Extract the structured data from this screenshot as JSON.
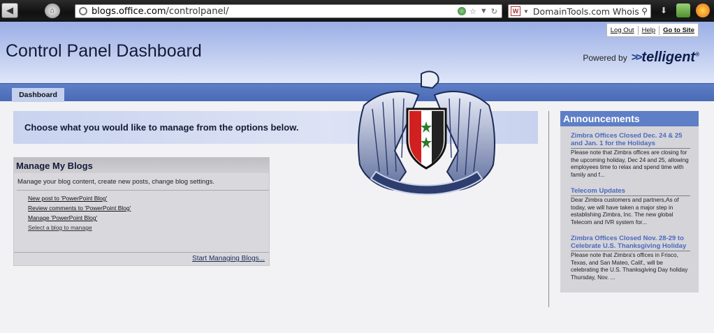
{
  "browser": {
    "url_host": "blogs.office.com",
    "url_path": "/controlpanel/",
    "search_text": "DomainTools.com Whois"
  },
  "header": {
    "title": "Control Panel Dashboard",
    "links": {
      "logout": "Log Out",
      "help": "Help",
      "goto": "Go to Site"
    },
    "powered_label": "Powered by",
    "brand": "telligent",
    "brand_mark": "®"
  },
  "nav": {
    "tab": "Dashboard"
  },
  "choose": {
    "text": "Choose what you would like to manage from the options below."
  },
  "blogs": {
    "title": "Manage My Blogs",
    "description": "Manage your blog content, create new posts, change blog settings.",
    "links": [
      "New post to 'PowerPoint Blog'",
      "Review comments to 'PowerPoint Blog'",
      "Manage 'PowerPoint Blog'",
      "Select a blog to manage"
    ],
    "footer_link": "Start Managing Blogs..."
  },
  "announcements": {
    "title": "Announcements",
    "items": [
      {
        "title": "Zimbra Offices Closed Dec. 24 & 25 and Jan. 1 for the Holidays",
        "body": "Please note that Zimbra offices are closing for the upcoming holiday, Dec 24 and 25, allowing employees time to relax and spend time with family and f..."
      },
      {
        "title": "Telecom Updates",
        "body": "Dear Zimbra customers and partners,As of today, we will have taken a major step in establishing Zimbra, Inc. The new global Telecom and IVR system for..."
      },
      {
        "title": "Zimbra Offices Closed Nov. 28-29 to Celebrate U.S. Thanksgiving Holiday",
        "body": "Please note that Zimbra's offices in Frisco, Texas, and San Mateo, Calif., will be celebrating the U.S. Thanksgiving Day holiday Thursday, Nov. ..."
      }
    ]
  },
  "colors": {
    "nav_blue": "#5e7ec6",
    "header_blue": "#9aaee6",
    "link_blue": "#4b69bd"
  },
  "icons": [
    "back-arrow-icon",
    "home-icon",
    "globe-icon",
    "bookmark-star-icon",
    "reload-icon",
    "search-icon",
    "download-icon",
    "emblem-image"
  ]
}
